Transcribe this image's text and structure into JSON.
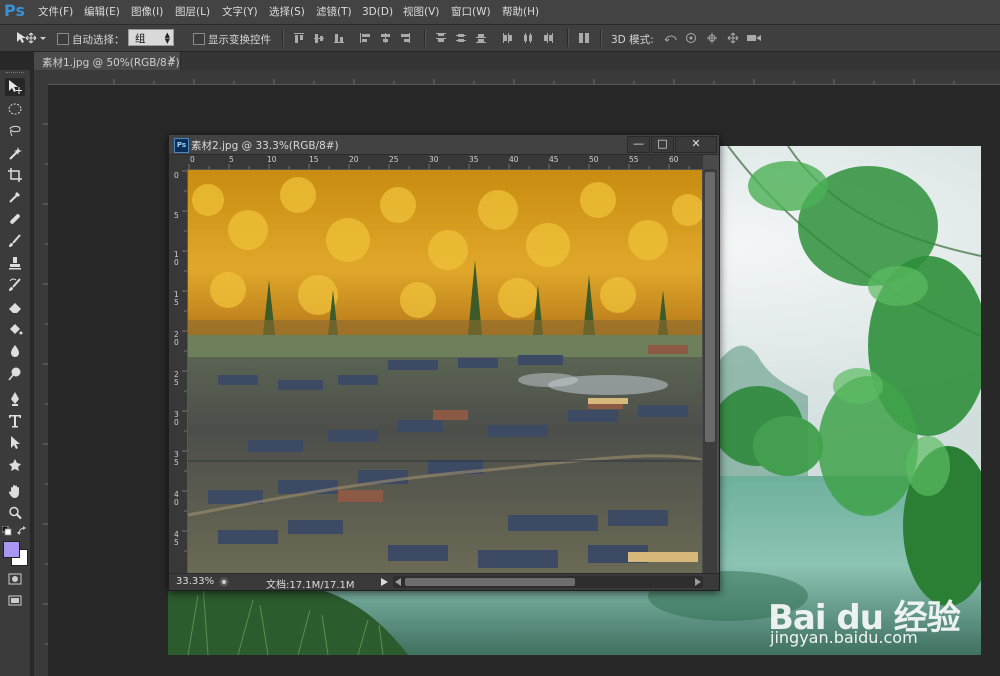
{
  "app": {
    "logo": "Ps"
  },
  "menu": [
    "文件(F)",
    "编辑(E)",
    "图像(I)",
    "图层(L)",
    "文字(Y)",
    "选择(S)",
    "滤镜(T)",
    "3D(D)",
    "视图(V)",
    "窗口(W)",
    "帮助(H)"
  ],
  "options": {
    "auto_select_label": "自动选择：",
    "auto_select_value": "组",
    "show_transform_label": "显示变换控件",
    "mode_label": "3D 模式:"
  },
  "tabs": [
    {
      "label": "素材1.jpg @ 50%(RGB/8#)",
      "close": "×"
    }
  ],
  "float_window": {
    "title": "素材2.jpg @ 33.3%(RGB/8#)",
    "ps_badge": "Ps",
    "min": "—",
    "max": "□",
    "close": "✕",
    "h_ruler": [
      "0",
      "5",
      "10",
      "15",
      "20",
      "25",
      "30",
      "35",
      "40",
      "45",
      "50",
      "55",
      "60"
    ],
    "v_ruler": [
      "0",
      "5",
      "1 0",
      "1 5",
      "2 0",
      "2 5",
      "3 0",
      "3 5",
      "4 0",
      "4 5"
    ],
    "zoom": "33.33%",
    "doc_info": "文档:17.1M/17.1M"
  },
  "watermark": {
    "brand": "Bai du 经验",
    "url": "jingyan.baidu.com"
  },
  "colors": {
    "foreground": "#a996f0",
    "background": "#ffffff",
    "ps_blue": "#3c8fd1"
  }
}
